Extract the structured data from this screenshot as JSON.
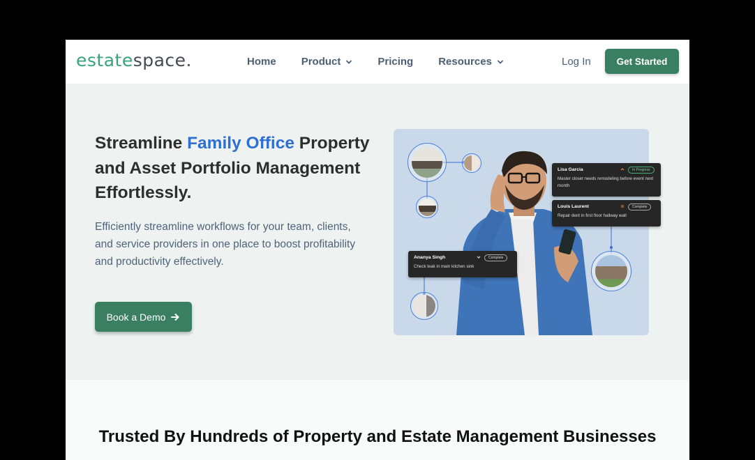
{
  "brand": {
    "logo_part1": "estate",
    "logo_part2": "space."
  },
  "nav": {
    "items": [
      {
        "label": "Home",
        "has_dropdown": false
      },
      {
        "label": "Product",
        "has_dropdown": true
      },
      {
        "label": "Pricing",
        "has_dropdown": false
      },
      {
        "label": "Resources",
        "has_dropdown": true
      }
    ],
    "login": "Log In",
    "cta": "Get Started"
  },
  "hero": {
    "title_part1": "Streamline ",
    "title_accent": "Family Office",
    "title_part2": " Property and Asset Portfolio Management Effortlessly.",
    "subtitle": "Efficiently streamline workflows for your team, clients, and service providers in one place to boost profitability and productivity effectively.",
    "demo_button": "Book a Demo",
    "cards": [
      {
        "name": "Lisa Garcia",
        "status": "In Progress",
        "message": "Master closet needs remodeling before event next month"
      },
      {
        "name": "Louis Laurent",
        "status": "Complete",
        "message": "Repair dent in first floor hallway wall"
      },
      {
        "name": "Ananya Singh",
        "status": "Complete",
        "message": "Check leak in main kitchen sink"
      }
    ]
  },
  "trusted": {
    "heading": "Trusted By Hundreds of Property and Estate Management Businesses"
  },
  "colors": {
    "accent_green": "#3b7f62",
    "accent_blue": "#2f6fcf",
    "hero_bg": "#eef3f1",
    "visual_bg": "#c9d9ea"
  },
  "icons": [
    "chevron-down-icon",
    "arrow-right-icon"
  ]
}
